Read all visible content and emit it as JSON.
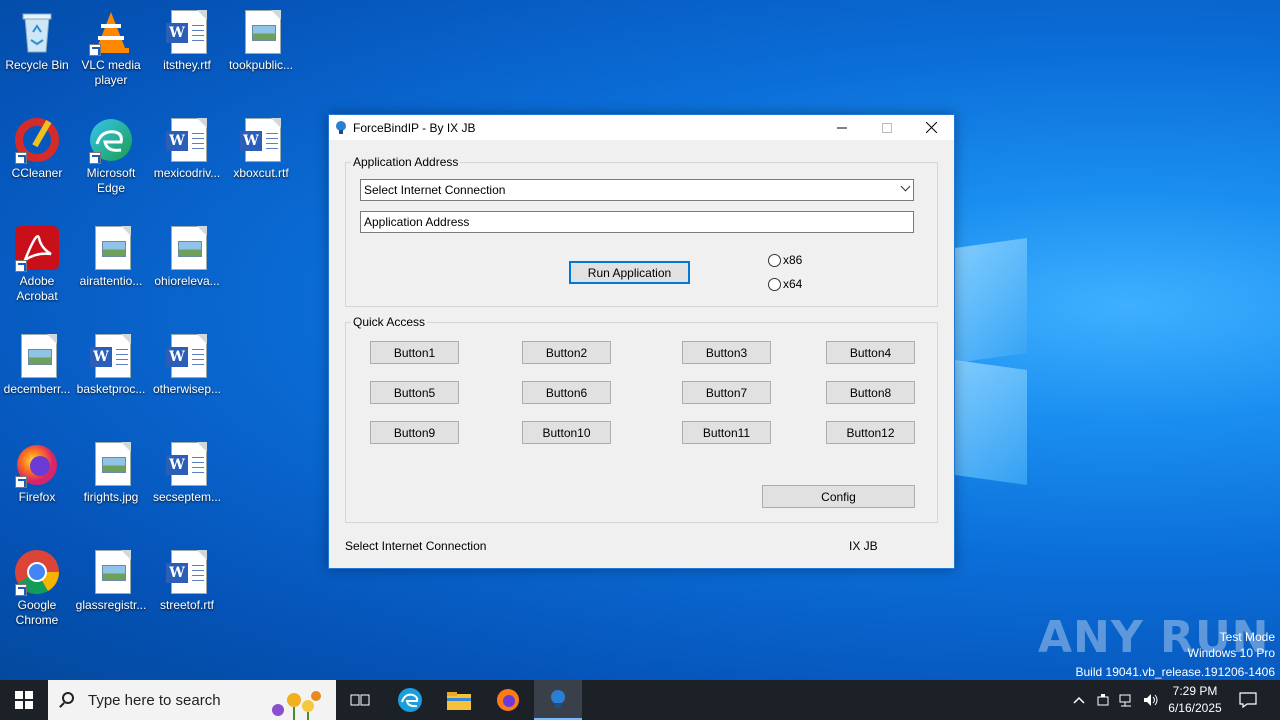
{
  "desktop": {
    "icons": [
      {
        "label": "Recycle Bin"
      },
      {
        "label": "VLC media player"
      },
      {
        "label": "itsthey.rtf"
      },
      {
        "label": "tookpublic..."
      },
      {
        "label": "CCleaner"
      },
      {
        "label": "Microsoft Edge"
      },
      {
        "label": "mexicodriv..."
      },
      {
        "label": "xboxcut.rtf"
      },
      {
        "label": "Adobe Acrobat"
      },
      {
        "label": "airattentio..."
      },
      {
        "label": "ohiorelevа..."
      },
      {
        "label": "decemberr..."
      },
      {
        "label": "basketproc..."
      },
      {
        "label": "otherwisep..."
      },
      {
        "label": "Firefox"
      },
      {
        "label": "firights.jpg"
      },
      {
        "label": "secseptem..."
      },
      {
        "label": "Google Chrome"
      },
      {
        "label": "glassregistr..."
      },
      {
        "label": "streetof.rtf"
      }
    ]
  },
  "window": {
    "title": "ForceBindIP - By IX JB",
    "app_group_label": "Application Address",
    "connection_select_value": "Select Internet Connection",
    "address_input_value": "Application Address",
    "run_button": "Run Application",
    "radio_x86": "x86",
    "radio_x64": "x64",
    "quick_group_label": "Quick Access",
    "buttons": [
      "Button1",
      "Button2",
      "Button3",
      "Button4",
      "Button5",
      "Button6",
      "Button7",
      "Button8",
      "Button9",
      "Button10",
      "Button11",
      "Button12"
    ],
    "config_button": "Config",
    "status_left": "Select Internet Connection",
    "status_right": "IX JB"
  },
  "watermark": {
    "brand": "ANY RUN",
    "line1": "Test Mode",
    "line2": "Windows 10 Pro",
    "line3": "Build 19041.vb_release.191206-1406"
  },
  "taskbar": {
    "search_placeholder": "Type here to search",
    "time": "7:29 PM",
    "date": "6/16/2025"
  },
  "colors": {
    "accent": "#0078d7",
    "desktop": "#0a6fd6",
    "taskbar": "#1c2128"
  }
}
